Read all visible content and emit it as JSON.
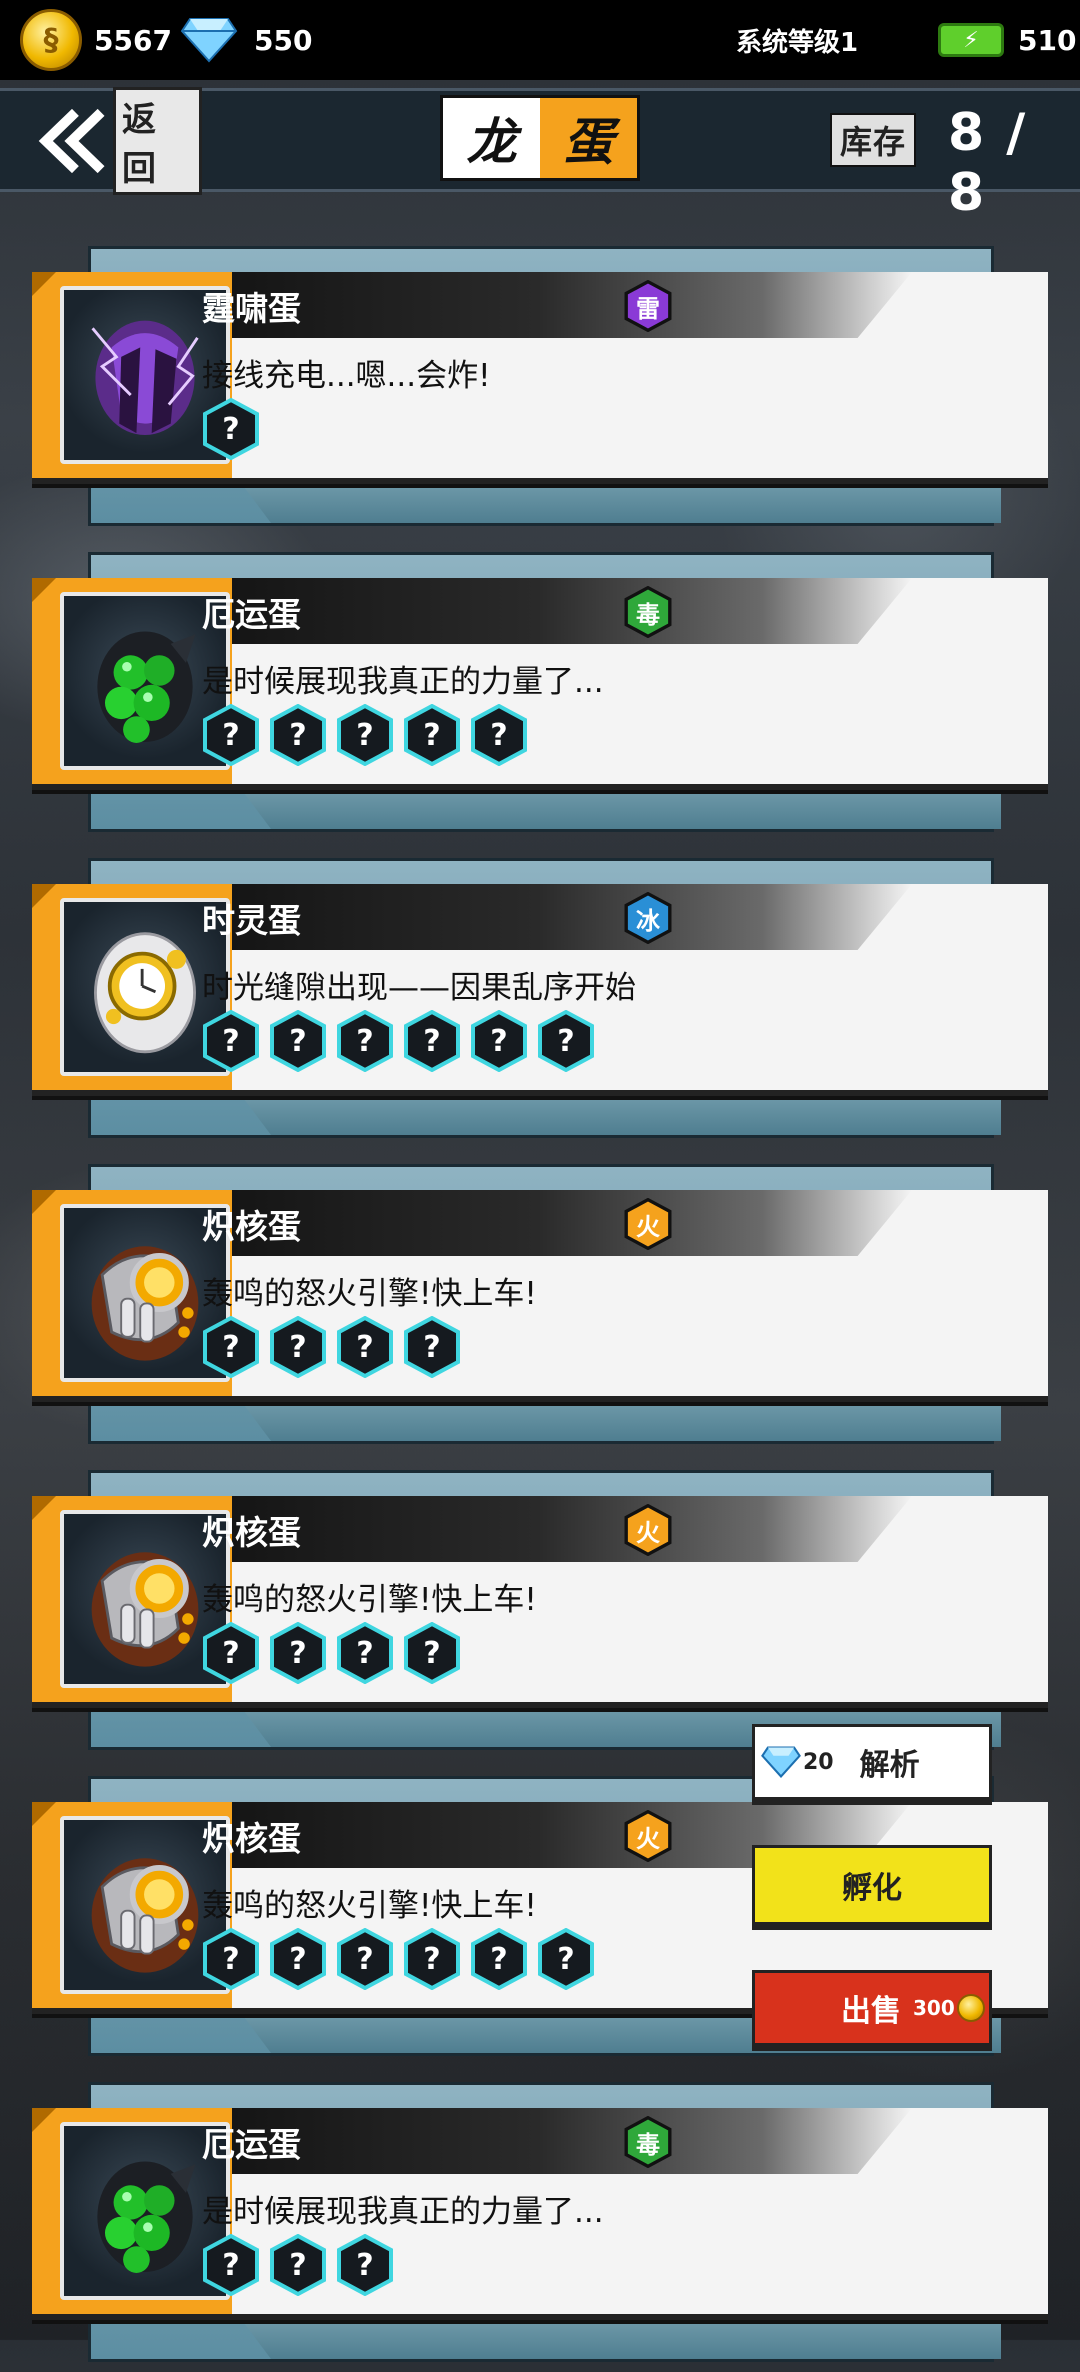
{
  "status_bar": {
    "coins": "5567",
    "gems": "550",
    "system_level": "系统等级1",
    "energy": "510"
  },
  "header": {
    "back_label": "返回",
    "title_left": "龙",
    "title_right": "蛋",
    "stock_label": "库存",
    "stock_value": "8 / 8"
  },
  "colors": {
    "accent_orange": "#f5a21d",
    "hatch_yellow": "#f2e21a",
    "sell_red": "#d8321c",
    "thunder": "#8a3ad6",
    "poison": "#2fa83a",
    "ice": "#2a8fd6",
    "fire": "#f5a21d"
  },
  "eggs": [
    {
      "name": "霆啸蛋",
      "element": "雷",
      "element_color": "#8a3ad6",
      "icon": "thunder-egg-icon",
      "desc": "接线充电...嗯...会炸!",
      "unknown_count": 1
    },
    {
      "name": "厄运蛋",
      "element": "毒",
      "element_color": "#2fa83a",
      "icon": "doom-egg-icon",
      "desc": "是时候展现我真正的力量了...",
      "unknown_count": 5
    },
    {
      "name": "时灵蛋",
      "element": "冰",
      "element_color": "#2a8fd6",
      "icon": "time-egg-icon",
      "desc": "时光缝隙出现——因果乱序开始",
      "unknown_count": 6
    },
    {
      "name": "炽核蛋",
      "element": "火",
      "element_color": "#f5a21d",
      "icon": "core-egg-icon",
      "desc": "轰鸣的怒火引擎!快上车!",
      "unknown_count": 4
    },
    {
      "name": "炽核蛋",
      "element": "火",
      "element_color": "#f5a21d",
      "icon": "core-egg-icon",
      "desc": "轰鸣的怒火引擎!快上车!",
      "unknown_count": 4
    },
    {
      "name": "炽核蛋",
      "element": "火",
      "element_color": "#f5a21d",
      "icon": "core-egg-icon",
      "desc": "轰鸣的怒火引擎!快上车!",
      "unknown_count": 6
    },
    {
      "name": "厄运蛋",
      "element": "毒",
      "element_color": "#2fa83a",
      "icon": "doom-egg-icon",
      "desc": "是时候展现我真正的力量了...",
      "unknown_count": 3
    }
  ],
  "unknown_symbol": "?",
  "actions": {
    "analyze_cost": "20",
    "analyze_label": "解析",
    "hatch_label": "孵化",
    "sell_label": "出售",
    "sell_price": "300"
  }
}
